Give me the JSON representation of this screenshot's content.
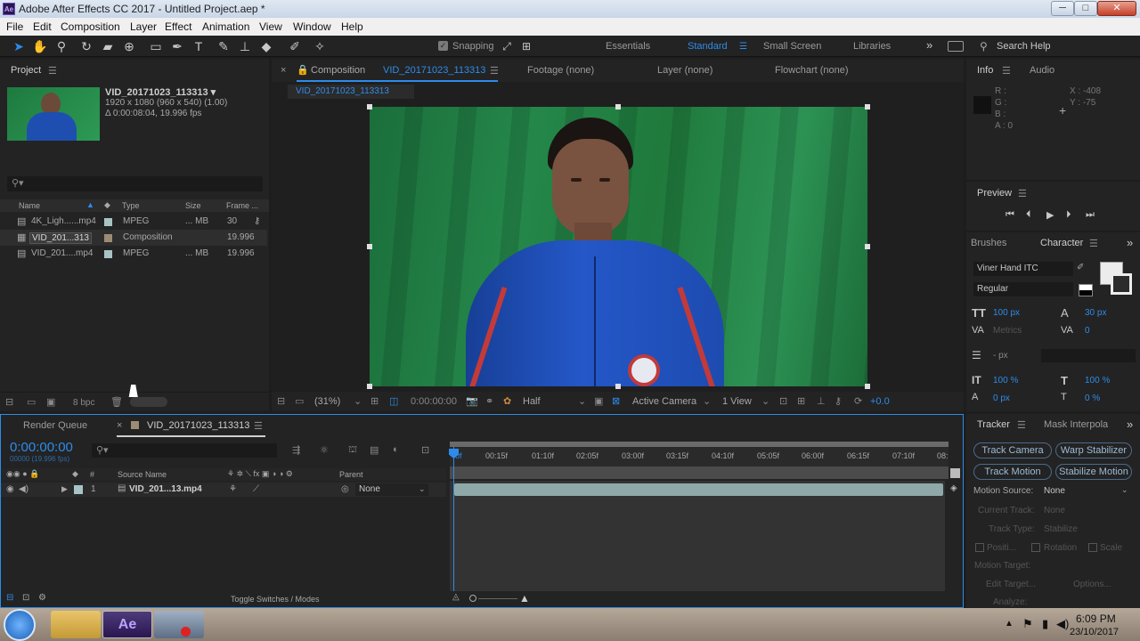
{
  "window": {
    "title": "Adobe After Effects CC 2017 - Untitled Project.aep *",
    "app_icon": "Ae",
    "minimize": "─",
    "maximize": "□",
    "close": "✕"
  },
  "menu": [
    "File",
    "Edit",
    "Composition",
    "Layer",
    "Effect",
    "Animation",
    "View",
    "Window",
    "Help"
  ],
  "toolbar": {
    "snapping": "Snapping",
    "workspaces": [
      "Essentials",
      "Standard",
      "Small Screen",
      "Libraries"
    ],
    "active_workspace": "Standard",
    "more": "»",
    "search_help": "Search Help"
  },
  "project": {
    "tab": "Project",
    "selected": {
      "name": "VID_20171023_113313 ▾",
      "line1": "1920 x 1080  (960 x 540) (1.00)",
      "line2": "Δ 0:00:08:04, 19.996 fps"
    },
    "search_placeholder": "",
    "columns": [
      "Name",
      "Type",
      "Size",
      "Frame ..."
    ],
    "items": [
      {
        "name": "4K_Ligh......mp4",
        "type": "MPEG",
        "size": "... MB",
        "fps": "30",
        "color": "#a7c4c4"
      },
      {
        "name": "VID_201...313",
        "type": "Composition",
        "size": "",
        "fps": "19.996",
        "color": "#9d8c74"
      },
      {
        "name": "VID_201....mp4",
        "type": "MPEG",
        "size": "... MB",
        "fps": "19.996",
        "color": "#a7c4c4"
      }
    ],
    "bpc": "8 bpc"
  },
  "comp_viewer": {
    "tabs": {
      "composition_prefix": "Composition",
      "composition": "VID_20171023_113313",
      "footage": "Footage (none)",
      "layer": "Layer (none)",
      "flowchart": "Flowchart (none)"
    },
    "subtab": "VID_20171023_113313",
    "zoom": "(31%)",
    "timecode": "0:00:00:00",
    "resolution": "Half",
    "camera": "Active Camera",
    "view": "1 View",
    "exposure": "+0.0"
  },
  "info": {
    "tab": "Info",
    "audio_tab": "Audio",
    "r": "R :",
    "g": "G :",
    "b": "B :",
    "a": "A : 0",
    "x": "X : -408",
    "y": "Y : -75"
  },
  "preview": {
    "tab": "Preview"
  },
  "character": {
    "tabs": [
      "Brushes",
      "Character"
    ],
    "font": "Viner Hand ITC",
    "style": "Regular",
    "size": "100 px",
    "leading": "30 px",
    "kerning": "Metrics",
    "tracking": "0",
    "stroke": "- px",
    "vscale": "100 %",
    "hscale": "100 %",
    "baseline": "0 px",
    "tsume": "0 %"
  },
  "timeline": {
    "render_queue": "Render Queue",
    "comp_tab": "VID_20171023_113313",
    "timecode": "0:00:00:00",
    "timecode_sub": "00000 (19.996 fps)",
    "col_num": "#",
    "col_source": "Source Name",
    "col_parent": "Parent",
    "ruler": [
      "0f",
      "00:15f",
      "01:10f",
      "02:05f",
      "03:00f",
      "03:15f",
      "04:10f",
      "05:05f",
      "06:00f",
      "06:15f",
      "07:10f",
      "08:"
    ],
    "layers": [
      {
        "num": "1",
        "name": "VID_201...13.mp4",
        "parent": "None"
      }
    ],
    "toggle": "Toggle Switches / Modes"
  },
  "tracker": {
    "tabs": [
      "Tracker",
      "Mask Interpola"
    ],
    "buttons": [
      "Track Camera",
      "Warp Stabilizer",
      "Track Motion",
      "Stabilize Motion"
    ],
    "motion_source_label": "Motion Source:",
    "motion_source": "None",
    "current_track_label": "Current Track:",
    "current_track": "None",
    "track_type_label": "Track Type:",
    "track_type": "Stabilize",
    "position": "Positi...",
    "rotation": "Rotation",
    "scale": "Scale",
    "motion_target": "Motion Target:",
    "edit_target": "Edit Target...",
    "options": "Options...",
    "analyze": "Analyze:"
  },
  "taskbar": {
    "time": "6:09 PM",
    "date": "23/10/2017",
    "ae_label": "Ae"
  },
  "colors": {
    "accent": "#2d8ceb",
    "panel": "#232323",
    "green_screen": "#1f7a3c",
    "jacket": "#1e4fb0"
  }
}
